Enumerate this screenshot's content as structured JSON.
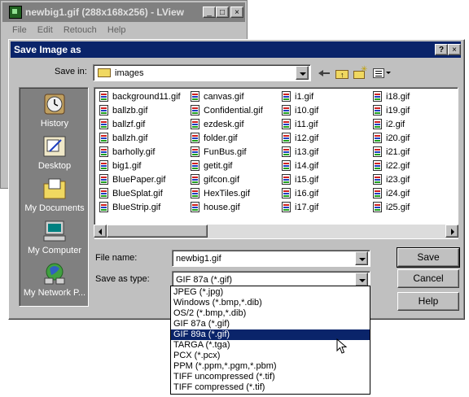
{
  "background_window": {
    "title": "newbig1.gif (288x168x256) - LView",
    "menu": [
      "File",
      "Edit",
      "Retouch",
      "Help"
    ],
    "buttons": {
      "minimize": "_",
      "maximize": "□",
      "close": "×"
    }
  },
  "dialog": {
    "title": "Save Image as",
    "help_btn": "?",
    "close_btn": "×",
    "save_in_label": "Save in:",
    "save_in_value": "images",
    "places": [
      {
        "label": "History",
        "icon": "history-icon"
      },
      {
        "label": "Desktop",
        "icon": "desktop-icon"
      },
      {
        "label": "My Documents",
        "icon": "my-documents-icon"
      },
      {
        "label": "My Computer",
        "icon": "my-computer-icon"
      },
      {
        "label": "My Network P...",
        "icon": "my-network-icon"
      }
    ],
    "files": [
      [
        "background11.gif",
        "ballzb.gif",
        "ballzf.gif",
        "ballzh.gif",
        "barholly.gif",
        "big1.gif",
        "BluePaper.gif",
        "BlueSplat.gif",
        "BlueStrip.gif"
      ],
      [
        "canvas.gif",
        "Confidential.gif",
        "ezdesk.gif",
        "folder.gif",
        "FunBus.gif",
        "getit.gif",
        "gifcon.gif",
        "HexTiles.gif",
        "house.gif"
      ],
      [
        "i1.gif",
        "i10.gif",
        "i11.gif",
        "i12.gif",
        "i13.gif",
        "i14.gif",
        "i15.gif",
        "i16.gif",
        "i17.gif"
      ],
      [
        "i18.gif",
        "i19.gif",
        "i2.gif",
        "i20.gif",
        "i21.gif",
        "i22.gif",
        "i23.gif",
        "i24.gif",
        "i25.gif"
      ]
    ],
    "file_name_label": "File name:",
    "file_name_value": "newbig1.gif",
    "save_type_label": "Save as type:",
    "save_type_value": "GIF 87a (*.gif)",
    "buttons": {
      "save": "Save",
      "cancel": "Cancel",
      "help": "Help"
    },
    "type_options": [
      "JPEG (*.jpg)",
      "Windows (*.bmp,*.dib)",
      "OS/2 (*.bmp,*.dib)",
      "GIF 87a (*.gif)",
      "GIF 89a (*.gif)",
      "TARGA (*.tga)",
      "PCX (*.pcx)",
      "PPM (*.ppm,*.pgm,*.pbm)",
      "TIFF uncompressed (*.tif)",
      "TIFF compressed (*.tif)"
    ],
    "selected_type_index": 4
  },
  "colors": {
    "title_active": "#0a246a",
    "title_inactive": "#808080",
    "face": "#c0c0c0",
    "selection": "#0a246a"
  }
}
